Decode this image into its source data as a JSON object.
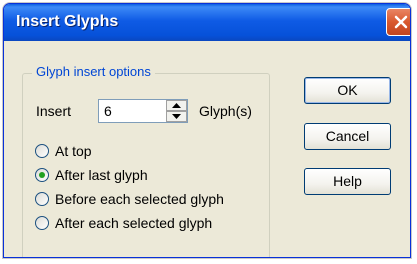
{
  "dialog": {
    "title": "Insert Glyphs"
  },
  "group": {
    "label": "Glyph insert options",
    "insert_label": "Insert",
    "insert_value": "6",
    "units_label": "Glyph(s)",
    "options": [
      {
        "label": "At top",
        "selected": false
      },
      {
        "label": "After last glyph",
        "selected": true
      },
      {
        "label": "Before each selected glyph",
        "selected": false
      },
      {
        "label": "After each selected glyph",
        "selected": false
      }
    ]
  },
  "buttons": {
    "ok": "OK",
    "cancel": "Cancel",
    "help": "Help"
  },
  "colors": {
    "titlebar": "#0a5fe0",
    "group_label": "#0046d5",
    "radio_selected": "#21a121",
    "close_button": "#d9592f"
  }
}
